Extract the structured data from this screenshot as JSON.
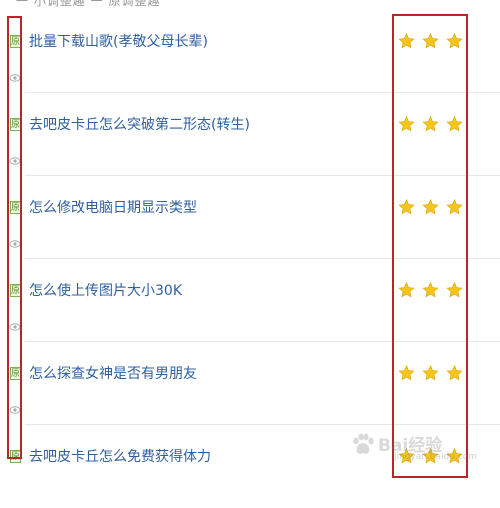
{
  "top_fragment": "一  小调整趣  一  原调整趣",
  "rows": [
    {
      "title": "批量下载山歌(孝敬父母长辈)",
      "badge": "原",
      "stars": 3
    },
    {
      "title": "去吧皮卡丘怎么突破第二形态(转生)",
      "badge": "原",
      "stars": 3
    },
    {
      "title": "怎么修改电脑日期显示类型",
      "badge": "原",
      "stars": 3
    },
    {
      "title": "怎么使上传图片大小30K",
      "badge": "原",
      "stars": 3
    },
    {
      "title": "怎么探查女神是否有男朋友",
      "badge": "原",
      "stars": 3
    },
    {
      "title": "去吧皮卡丘怎么免费获得体力",
      "badge": "原",
      "stars": 3
    }
  ],
  "watermark": {
    "brand": "Bai",
    "brand2": "经验",
    "url": "jingyan.baidu.com"
  },
  "colors": {
    "highlight_border": "#b8262b",
    "star": "#f5c518",
    "link": "#2f5fa0",
    "badge": "#7fae4f"
  }
}
